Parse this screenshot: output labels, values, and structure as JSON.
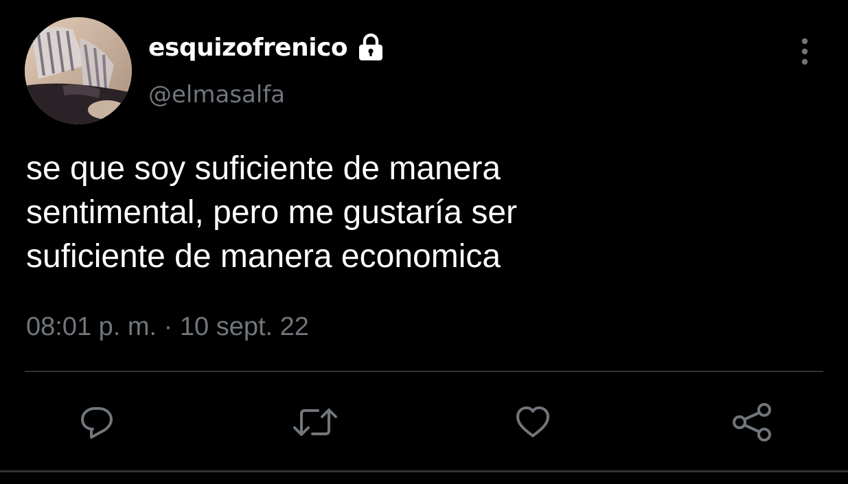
{
  "user": {
    "display_name": "esquizofrenico",
    "handle": "@elmasalfa",
    "protected_icon": "lock-icon"
  },
  "tweet": {
    "text": "se que soy suficiente de manera\nsentimental, pero me gustaría ser\nsuficiente de manera economica",
    "timestamp": "08:01 p. m. · 10 sept. 22"
  },
  "actions": [
    {
      "icon": "reply-icon"
    },
    {
      "icon": "retweet-icon"
    },
    {
      "icon": "like-icon"
    },
    {
      "icon": "share-icon"
    }
  ],
  "colors": {
    "background": "#000000",
    "primary_text": "#ffffff",
    "secondary_text": "#71767b",
    "divider": "#2f3336"
  }
}
